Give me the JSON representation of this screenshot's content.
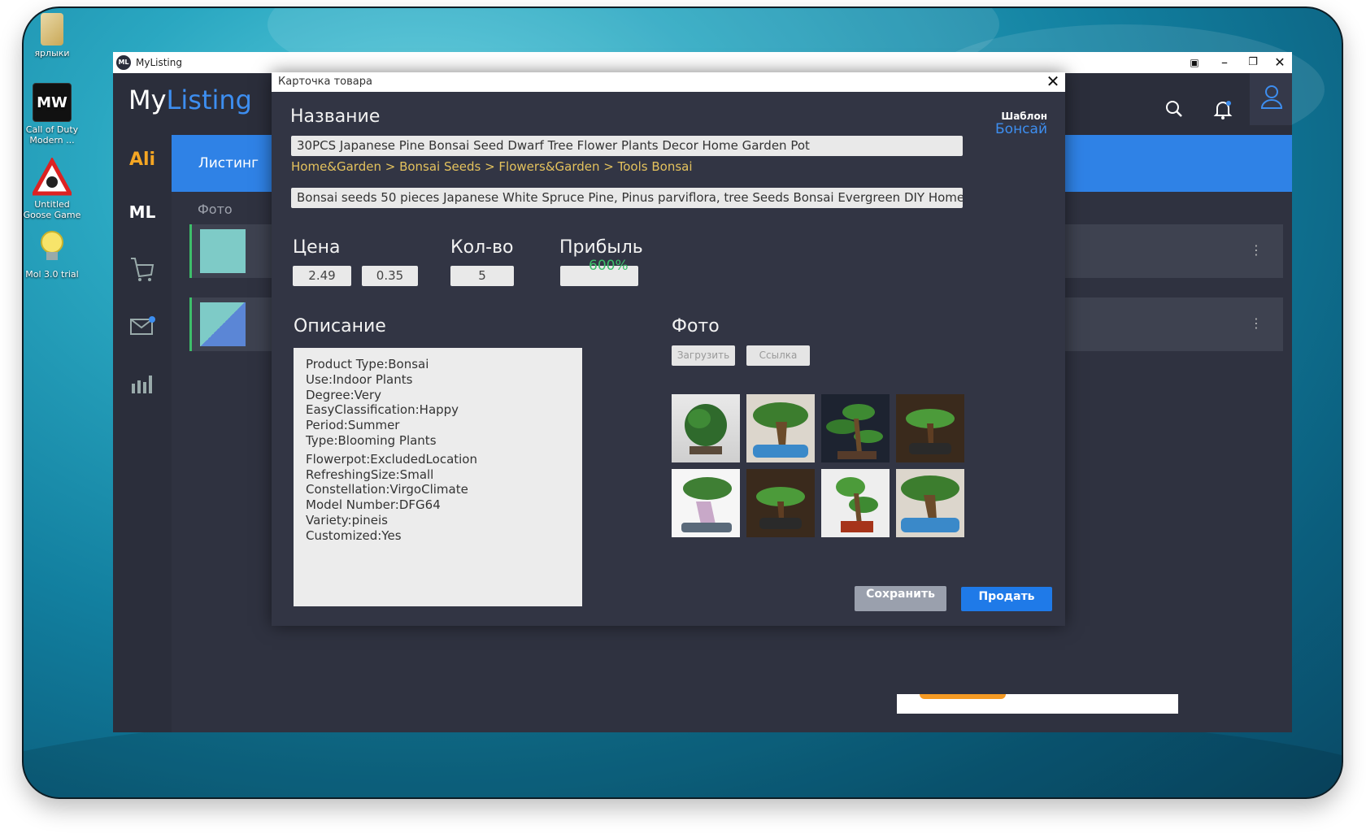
{
  "desktop": {
    "icons": [
      {
        "label": "ярлыки"
      },
      {
        "label": "Call of Duty Modern ..."
      },
      {
        "label": "Untitled Goose Game"
      },
      {
        "label": "Mol 3.0 trial"
      }
    ]
  },
  "window": {
    "title": "MyListing",
    "logo_text": "ML"
  },
  "brand": {
    "part1": "My",
    "part2": "Listing"
  },
  "sidebar": {
    "items": [
      {
        "label": "Ali"
      },
      {
        "label": "ML"
      }
    ]
  },
  "main": {
    "tab_active": "Листинг",
    "col_photo": "Фото"
  },
  "modal": {
    "title": "Карточка товара",
    "name_label": "Название",
    "template_label": "Шаблон",
    "template_value": "Бонсай",
    "title_value": "30PCS Japanese Pine Bonsai Seed Dwarf Tree Flower Plants Decor Home Garden Pot",
    "breadcrumb": "Home&Garden > Bonsai Seeds > Flowers&Garden > Tools Bonsai",
    "subtitle_value": "Bonsai seeds 50 pieces Japanese White Spruce Pine, Pinus parviflora, tree Seeds Bonsai Evergreen DIY Home",
    "price_label": "Цена",
    "price1": "2.49",
    "price2": "0.35",
    "qty_label": "Кол-во",
    "qty": "5",
    "profit_label": "Прибыль",
    "profit_pct": "600%",
    "desc_label": "Описание",
    "desc_lines": [
      "Product Type:Bonsai",
      "Use:Indoor Plants",
      "Degree:Very",
      "EasyClassification:Happy",
      "Period:Summer",
      "Type:Blooming Plants",
      "Flowerpot:ExcludedLocation",
      "RefreshingSize:Small",
      "Constellation:VirgoClimate",
      "Model Number:DFG64",
      "Variety:pineis",
      "Customized:Yes"
    ],
    "photo_label": "Фото",
    "upload_btn": "Загрузить",
    "link_btn": "Ссылка",
    "save_btn": "Сохранить",
    "sell_btn": "Продать"
  },
  "colors": {
    "accent": "#2f82e6",
    "brand_blue": "#3d8ef0",
    "ali_orange": "#f5a623",
    "profit_green": "#3dbf6a",
    "breadcrumb_gold": "#e4c25d"
  }
}
